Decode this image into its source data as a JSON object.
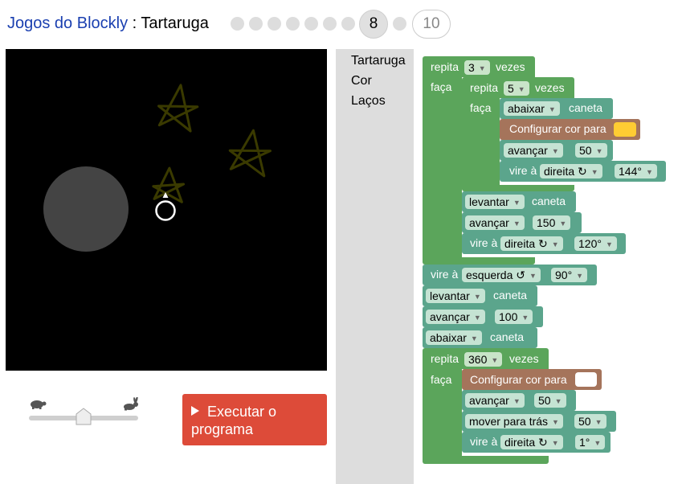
{
  "header": {
    "app_link": "Jogos do Blockly",
    "separator": " : ",
    "game_name": "Tartaruga",
    "current_level": "8",
    "max_level": "10"
  },
  "speed": {
    "slow_icon": "turtle-icon",
    "fast_icon": "rabbit-icon",
    "value": 0.5
  },
  "run_button": {
    "label": "Executar o programa"
  },
  "toolbox": {
    "categories": [
      "Tartaruga",
      "Cor",
      "Laços"
    ]
  },
  "colors": {
    "canvas": "#000000",
    "star": "#3a3a00",
    "disk": "#444444",
    "turtle_marker": "#ffffff",
    "loop_block": "#5ba55b",
    "turtle_block": "#5ba58c",
    "colour_block": "#a5745b",
    "run_button": "#dd4b39",
    "swatch_yellow": "#ffcc33",
    "swatch_white": "#ffffff"
  },
  "blocks": {
    "repeat_outer": {
      "label": "repita",
      "count": "3",
      "suffix": "vezes",
      "do": "faça"
    },
    "repeat_inner": {
      "label": "repita",
      "count": "5",
      "suffix": "vezes",
      "do": "faça"
    },
    "pen_down_1": {
      "dir": "abaixar",
      "suffix": "caneta"
    },
    "set_color_1": {
      "label": "Configurar cor para",
      "color": "#ffcc33"
    },
    "move_1": {
      "dir": "avançar",
      "value": "50"
    },
    "turn_1": {
      "label": "vire à",
      "dir": "direita ↻",
      "value": "144°"
    },
    "pen_up_1": {
      "dir": "levantar",
      "suffix": "caneta"
    },
    "move_2": {
      "dir": "avançar",
      "value": "150"
    },
    "turn_2": {
      "label": "vire à",
      "dir": "direita ↻",
      "value": "120°"
    },
    "turn_3": {
      "label": "vire à",
      "dir": "esquerda ↺",
      "value": "90°"
    },
    "pen_up_2": {
      "dir": "levantar",
      "suffix": "caneta"
    },
    "move_3": {
      "dir": "avançar",
      "value": "100"
    },
    "pen_down_2": {
      "dir": "abaixar",
      "suffix": "caneta"
    },
    "repeat_360": {
      "label": "repita",
      "count": "360",
      "suffix": "vezes",
      "do": "faça"
    },
    "set_color_2": {
      "label": "Configurar cor para",
      "color": "#ffffff"
    },
    "move_4": {
      "dir": "avançar",
      "value": "50"
    },
    "move_back": {
      "dir": "mover para trás",
      "value": "50"
    },
    "turn_4": {
      "label": "vire à",
      "dir": "direita ↻",
      "value": "1°"
    }
  }
}
